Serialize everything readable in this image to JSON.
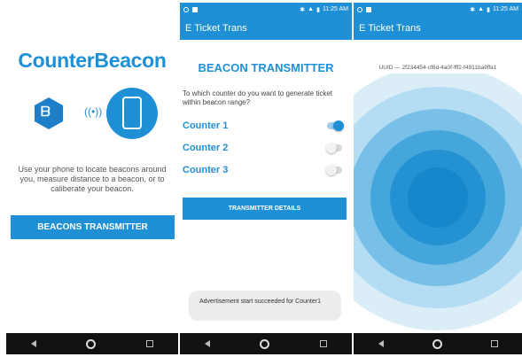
{
  "screen1": {
    "title": "CounterBeacon",
    "description": "Use your phone to locate beacons around you, measure distance to a beacon, or to caliberate your beacon.",
    "button_label": "BEACONS TRANSMITTER",
    "icons": [
      "beacon-hex-icon",
      "broadcast-signal-icon",
      "smartphone-icon"
    ]
  },
  "screen2": {
    "status": {
      "time": "11:25 AM"
    },
    "app_title": "E Ticket Trans",
    "heading": "BEACON TRANSMITTER",
    "question": "To which counter do you want to generate ticket within beacon range?",
    "counters": [
      {
        "label": "Counter 1",
        "on": true
      },
      {
        "label": "Counter 2",
        "on": false
      },
      {
        "label": "Counter 3",
        "on": false
      }
    ],
    "details_button": "TRANSMITTER DETAILS",
    "toast": "Advertisement start succeeded for Counter1"
  },
  "screen3": {
    "status": {
      "time": "11:25 AM"
    },
    "app_title": "E Ticket Trans",
    "uuid_text": "UUID --- 2f234454-cf6d-4a0f-fff2-f4911ba9ffa1"
  },
  "colors": {
    "accent": "#1f8fd6",
    "ripple": [
      "#dbeef8",
      "#b4dcf2",
      "#79c0e8",
      "#45a6dc",
      "#2492d2",
      "#1787cb"
    ]
  }
}
